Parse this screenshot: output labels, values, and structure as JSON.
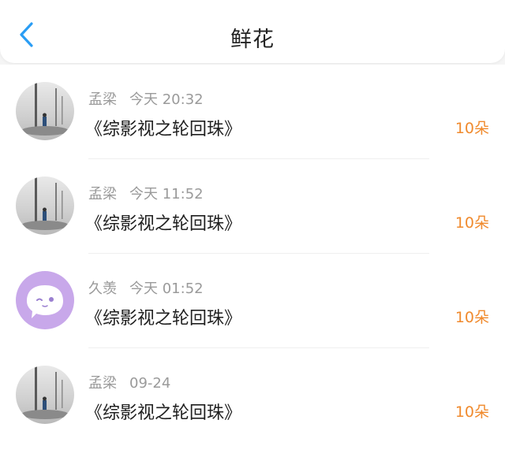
{
  "header": {
    "title": "鲜花",
    "back_icon": "chevron-left-icon",
    "accent_color": "#2a9df4"
  },
  "entries": [
    {
      "user": "孟梁",
      "time": "今天 20:32",
      "book": "《综影视之轮回珠》",
      "count": "10朵",
      "avatar": "photo-avatar"
    },
    {
      "user": "孟梁",
      "time": "今天 11:52",
      "book": "《综影视之轮回珠》",
      "count": "10朵",
      "avatar": "photo-avatar"
    },
    {
      "user": "久羡",
      "time": "今天 01:52",
      "book": "《综影视之轮回珠》",
      "count": "10朵",
      "avatar": "cartoon-avatar"
    },
    {
      "user": "孟梁",
      "time": "09-24",
      "book": "《综影视之轮回珠》",
      "count": "10朵",
      "avatar": "photo-avatar"
    }
  ],
  "colors": {
    "count": "#f08a2d",
    "meta": "#9a9a9a",
    "avatar_purple": "#c8a8ea"
  }
}
